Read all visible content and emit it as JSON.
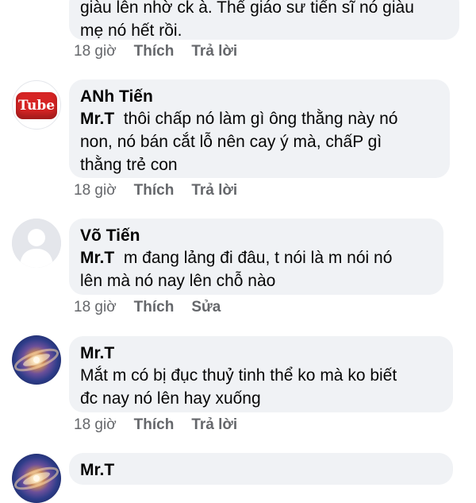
{
  "comments": [
    {
      "author": "",
      "tag": "",
      "body_lines": [
        "giàu lên nhờ ck à. Thế giáo sư tiến sĩ nó giàu",
        "mẹ nó hết rồi."
      ],
      "time": "18 giờ",
      "action1": "Thích",
      "action2": "Trả lời"
    },
    {
      "author": "ANh Tiến",
      "tag": "Mr.T",
      "body_lines": [
        "thôi chấp nó làm gì ông thằng này nó",
        "non, nó bán cắt lỗ nên cay ý mà, chấP gì",
        "thằng trẻ con"
      ],
      "time": "18 giờ",
      "action1": "Thích",
      "action2": "Trả lời",
      "avatar_text": "Tube"
    },
    {
      "author": "Võ Tiến",
      "tag": "Mr.T",
      "body_lines": [
        "m đang lảng đi đâu, t nói là m nói nó",
        "lên mà nó nay lên chỗ nào"
      ],
      "time": "18 giờ",
      "action1": "Thích",
      "action2": "Sửa"
    },
    {
      "author": "Mr.T",
      "tag": "",
      "body_lines": [
        "Mắt m có bị đục thuỷ tinh thể ko mà ko biết",
        "đc nay nó lên hay xuống"
      ],
      "time": "18 giờ",
      "action1": "Thích",
      "action2": "Trả lời"
    },
    {
      "author": "Mr.T",
      "tag": "",
      "body_lines": [],
      "time": "",
      "action1": "",
      "action2": ""
    }
  ],
  "colors": {
    "bubble": "#f0f2f5",
    "text": "#050505",
    "meta": "#65676b",
    "youtube_red": "#d62424"
  }
}
